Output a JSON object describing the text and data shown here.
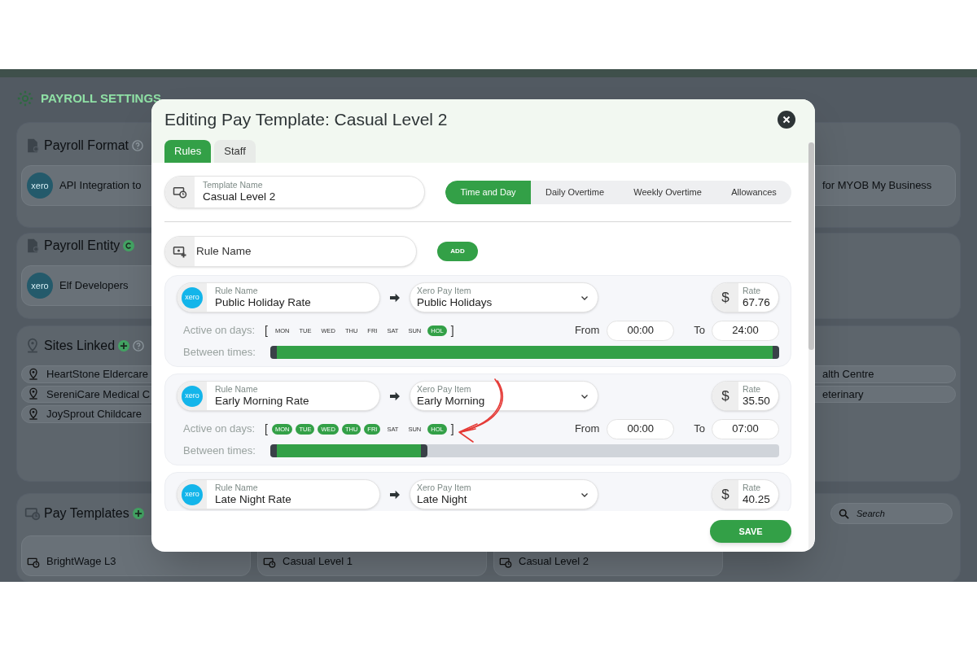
{
  "background": {
    "title": "PAYROLL SETTINGS",
    "sections": [
      {
        "heading": "Payroll Format",
        "items": [
          {
            "text": "API Integration to",
            "logo": "xero"
          }
        ],
        "right_items": [
          {
            "text": "for MYOB My Business"
          }
        ]
      },
      {
        "heading": "Payroll Entity",
        "items": [
          {
            "text": "Elf Developers",
            "logo": "xero"
          }
        ]
      },
      {
        "heading": "Sites Linked",
        "items": [
          {
            "text": "HeartStone Eldercare"
          },
          {
            "text": "SereniCare Medical C"
          },
          {
            "text": "JoySprout Childcare"
          }
        ],
        "right_items": [
          {
            "text": "alth Centre"
          },
          {
            "text": "eterinary"
          }
        ]
      },
      {
        "heading": "Pay Templates",
        "items": [
          {
            "text": "BrightWage L3"
          },
          {
            "text": "Casual Level 1"
          },
          {
            "text": "Casual Level 2"
          }
        ],
        "search": {
          "placeholder": "Search"
        }
      }
    ]
  },
  "modal": {
    "title": "Editing Pay Template: Casual Level 2",
    "tabs": [
      {
        "label": "Rules",
        "selected": true
      },
      {
        "label": "Staff",
        "selected": false
      }
    ],
    "template_name": {
      "label": "Template Name",
      "value": "Casual Level 2"
    },
    "rule_tabs": [
      {
        "label": "Time and Day",
        "selected": true
      },
      {
        "label": "Daily Overtime",
        "selected": false
      },
      {
        "label": "Weekly Overtime",
        "selected": false
      },
      {
        "label": "Allowances",
        "selected": false
      }
    ],
    "new_rule": {
      "placeholder": "Rule Name",
      "button": "ADD"
    },
    "rules": [
      {
        "logo": "xero",
        "name_label": "Rule Name",
        "name": "Public Holiday Rate",
        "pay_item_label": "Xero Pay Item",
        "pay_item": "Public Holidays",
        "currency": "$",
        "rate_label": "Rate",
        "rate": "67.76",
        "days_label": "Active on days:",
        "open_bracket": "[",
        "close_bracket": "]",
        "days": [
          {
            "label": "MON",
            "on": false
          },
          {
            "label": "TUE",
            "on": false
          },
          {
            "label": "WED",
            "on": false
          },
          {
            "label": "THU",
            "on": false
          },
          {
            "label": "FRI",
            "on": false
          },
          {
            "label": "SAT",
            "on": false
          },
          {
            "label": "SUN",
            "on": false
          },
          {
            "label": "HOL",
            "on": true
          }
        ],
        "from_label": "From",
        "from": "00:00",
        "to_label": "To",
        "to": "24:00",
        "times_label": "Between times:",
        "level": 1
      },
      {
        "logo": "xero",
        "name_label": "Rule Name",
        "name": "Early Morning Rate",
        "pay_item_label": "Xero Pay Item",
        "pay_item": "Early Morning",
        "currency": "$",
        "rate_label": "Rate",
        "rate": "35.50",
        "days_label": "Active on days:",
        "open_bracket": "[",
        "close_bracket": "]",
        "days": [
          {
            "label": "MON",
            "on": true
          },
          {
            "label": "TUE",
            "on": true
          },
          {
            "label": "WED",
            "on": true
          },
          {
            "label": "THU",
            "on": true
          },
          {
            "label": "FRI",
            "on": true
          },
          {
            "label": "SAT",
            "on": false
          },
          {
            "label": "SUN",
            "on": false
          },
          {
            "label": "HOL",
            "on": true
          }
        ],
        "from_label": "From",
        "from": "00:00",
        "to_label": "To",
        "to": "07:00",
        "times_label": "Between times:",
        "level": 0.29
      },
      {
        "logo": "xero",
        "name_label": "Rule Name",
        "name": "Late Night Rate",
        "pay_item_label": "Xero Pay Item",
        "pay_item": "Late Night",
        "currency": "$",
        "rate_label": "Rate",
        "rate": "40.25"
      }
    ],
    "save": "SAVE"
  }
}
